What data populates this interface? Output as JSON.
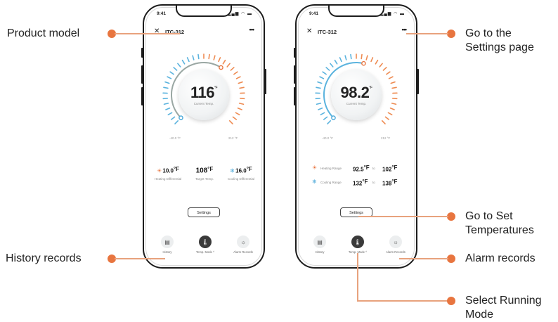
{
  "callouts": {
    "product_model": "Product model",
    "history_records": "History records",
    "go_settings": "Go to the\nSettings page",
    "go_set_temps": "Go to Set\nTemperatures",
    "alarm_records": "Alarm records",
    "select_mode": "Select Running\nMode"
  },
  "accent_color": "#e8753f",
  "phone_left": {
    "status_time": "9:41",
    "model": "ITC-312",
    "gauge": {
      "value": "116",
      "unit": "°F",
      "caption": "Current Temp.",
      "min": "-40.0 °F",
      "max": "212 °F"
    },
    "heating": {
      "value": "10.0",
      "unit": "°F",
      "label": "Heating Differential"
    },
    "target": {
      "value": "108",
      "unit": "°F",
      "label": "Target Temp."
    },
    "cooling": {
      "value": "16.0",
      "unit": "°F",
      "label": "Cooling Differential"
    },
    "settings_label": "Settings",
    "nav": {
      "history": "History",
      "mode": "Temp. Mode",
      "alarm": "Alarm Records"
    }
  },
  "phone_right": {
    "status_time": "9:41",
    "model": "ITC-312",
    "gauge": {
      "value": "98.2",
      "unit": "°F",
      "caption": "Current Temp.",
      "min": "-40.0 °F",
      "max": "212 °F"
    },
    "heating_range": {
      "label": "Heating Range",
      "from": "92.5",
      "to": "102",
      "unit": "°F",
      "sep": "to"
    },
    "cooling_range": {
      "label": "Cooling Range",
      "from": "132",
      "to": "138",
      "unit": "°F",
      "sep": "to"
    },
    "settings_label": "Settings",
    "nav": {
      "history": "History",
      "mode": "Temp. Mode",
      "alarm": "Alarm Records"
    }
  }
}
